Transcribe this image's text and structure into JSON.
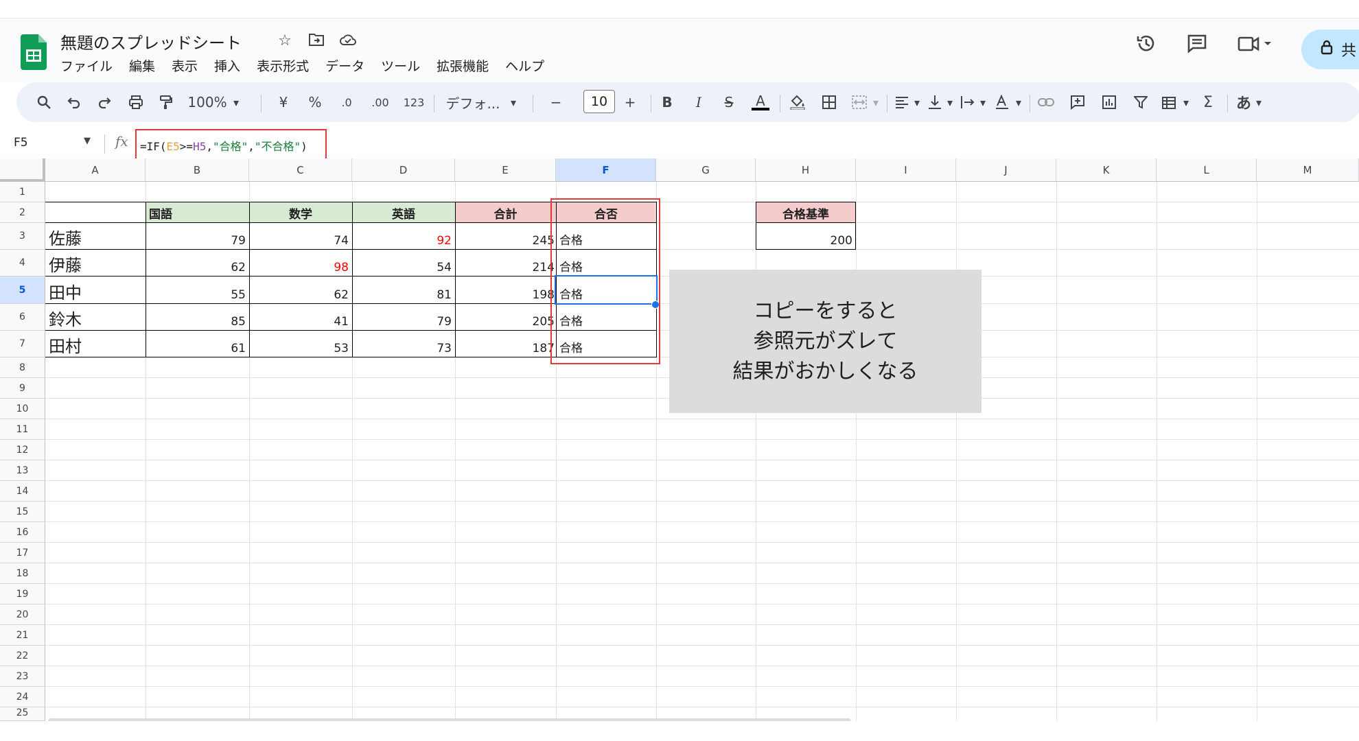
{
  "app": {
    "doc_title": "無題のスプレッドシート",
    "title_icons": [
      "star-icon",
      "move-to-folder-icon",
      "cloud-status-icon"
    ],
    "menu": [
      "ファイル",
      "編集",
      "表示",
      "挿入",
      "表示形式",
      "データ",
      "ツール",
      "拡張機能",
      "ヘルプ"
    ],
    "header_icons": [
      "version-history-icon",
      "comments-icon",
      "meet-icon"
    ],
    "share_label": "共"
  },
  "toolbar": {
    "zoom": "100%",
    "currency": "¥",
    "percent": "%",
    "decrease_decimal": ".0",
    "increase_decimal": ".00",
    "number_format": "123",
    "font": "デフォ...",
    "font_size": "10",
    "bold": "B",
    "italic": "I",
    "strike": "S",
    "text_color": "A",
    "sum": "Σ",
    "input_tool": "あ"
  },
  "formula_bar": {
    "name_box": "F5",
    "fx": "fx",
    "formula_parts": [
      "=IF(",
      "E5",
      ">=",
      "H5",
      ",",
      "\"合格\"",
      ",",
      "\"不合格\"",
      ")"
    ]
  },
  "columns": [
    "A",
    "B",
    "C",
    "D",
    "E",
    "F",
    "G",
    "H",
    "I",
    "J",
    "K",
    "L",
    "M"
  ],
  "rows": [
    "1",
    "2",
    "3",
    "4",
    "5",
    "6",
    "7",
    "8",
    "9",
    "10",
    "11",
    "12",
    "13",
    "14",
    "15",
    "16",
    "17",
    "18",
    "19",
    "20",
    "21",
    "22",
    "23",
    "24",
    "25"
  ],
  "selected_cell": "F5",
  "table": {
    "headers": [
      "",
      "国語",
      "数学",
      "英語",
      "合計",
      "合否"
    ],
    "rows": [
      {
        "name": "佐藤",
        "kokugo": "79",
        "sugaku": "74",
        "eigo": "92",
        "total": "245",
        "result": "合格"
      },
      {
        "name": "伊藤",
        "kokugo": "62",
        "sugaku": "98",
        "eigo": "54",
        "total": "214",
        "result": "合格"
      },
      {
        "name": "田中",
        "kokugo": "55",
        "sugaku": "62",
        "eigo": "81",
        "total": "198",
        "result": "合格"
      },
      {
        "name": "鈴木",
        "kokugo": "85",
        "sugaku": "41",
        "eigo": "79",
        "total": "205",
        "result": "合格"
      },
      {
        "name": "田村",
        "kokugo": "61",
        "sugaku": "53",
        "eigo": "73",
        "total": "187",
        "result": "合格"
      }
    ],
    "highlight_red": [
      "D3",
      "C4"
    ]
  },
  "criteria": {
    "label": "合格基準",
    "value": "200"
  },
  "callout": {
    "lines": [
      "コピーをすると",
      "参照元がズレて",
      "結果がおかしくなる"
    ]
  },
  "colors": {
    "header_green": "#d9ead3",
    "header_pink": "#f4cccc",
    "annotation_red": "#e53935",
    "selection_blue": "#1a73e8",
    "callout_bg": "#dcdcdc"
  }
}
